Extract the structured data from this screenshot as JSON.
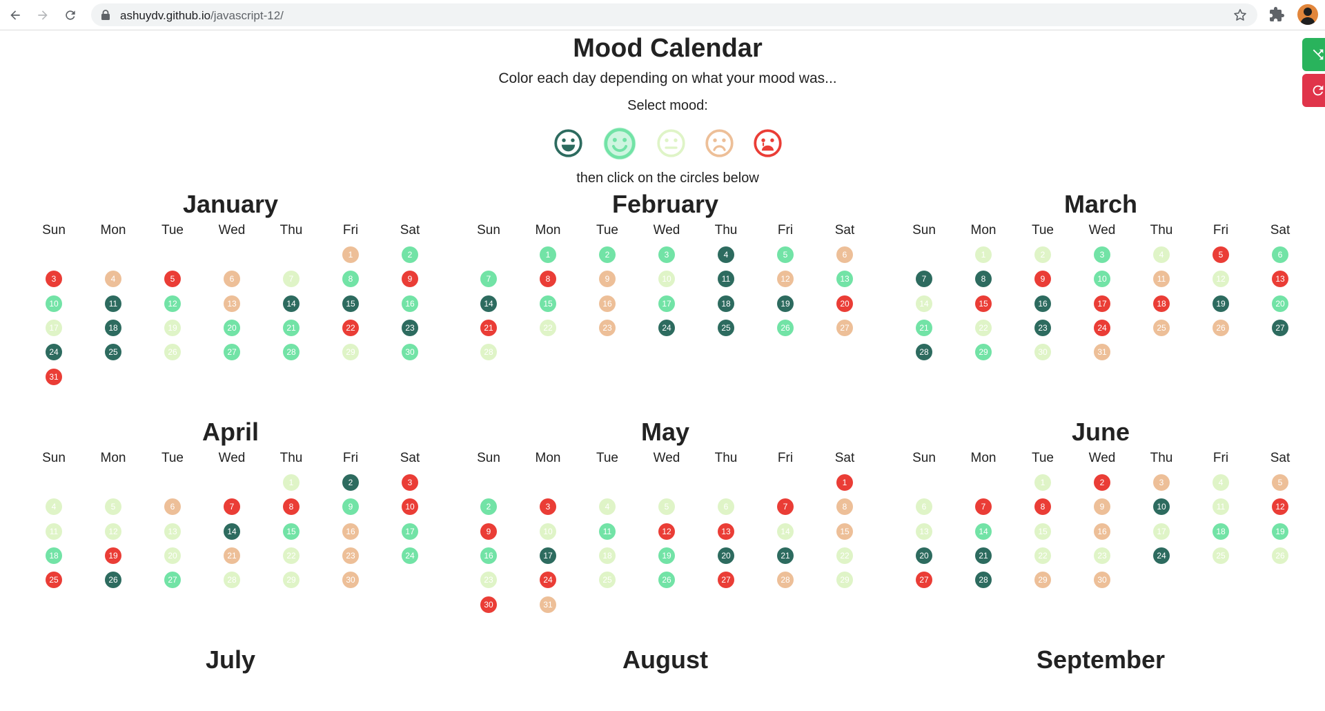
{
  "browser": {
    "url_host": "ashuydv.github.io",
    "url_path": "/javascript-12/"
  },
  "header": {
    "title": "Mood Calendar",
    "subtitle": "Color each day depending on what your mood was...",
    "select_label": "Select mood:",
    "hint": "then click on the circles below"
  },
  "colors": {
    "m1": "#2d6b5f",
    "m2": "#72e3a6",
    "m3": "#dff4c7",
    "m4": "#edbf98",
    "m5": "#ea3d36"
  },
  "moods": [
    {
      "name": "very-happy",
      "color": "#2d6b5f"
    },
    {
      "name": "happy",
      "color": "#72e3a6",
      "selected": true
    },
    {
      "name": "neutral",
      "color": "#dff4c7"
    },
    {
      "name": "sad",
      "color": "#edbf98"
    },
    {
      "name": "very-sad",
      "color": "#ea3d36"
    }
  ],
  "weekdays": [
    "Sun",
    "Mon",
    "Tue",
    "Wed",
    "Thu",
    "Fri",
    "Sat"
  ],
  "months": [
    {
      "name": "January",
      "start": 5,
      "days": 31,
      "moods": [
        4,
        2,
        5,
        4,
        5,
        4,
        3,
        2,
        5,
        2,
        1,
        2,
        4,
        1,
        1,
        2,
        3,
        1,
        3,
        2,
        2,
        5,
        1,
        1,
        1,
        3,
        2,
        2,
        3,
        2,
        5
      ]
    },
    {
      "name": "February",
      "start": 1,
      "days": 28,
      "moods": [
        2,
        2,
        2,
        1,
        2,
        4,
        2,
        5,
        4,
        3,
        1,
        4,
        2,
        1,
        2,
        4,
        2,
        1,
        1,
        5,
        5,
        3,
        4,
        1,
        1,
        2,
        4,
        3
      ]
    },
    {
      "name": "March",
      "start": 1,
      "days": 31,
      "moods": [
        3,
        3,
        2,
        3,
        5,
        2,
        1,
        1,
        5,
        2,
        4,
        3,
        5,
        3,
        5,
        1,
        5,
        5,
        1,
        2,
        2,
        3,
        1,
        5,
        4,
        4,
        1,
        1,
        2,
        3,
        4
      ]
    },
    {
      "name": "April",
      "start": 4,
      "days": 30,
      "moods": [
        3,
        1,
        5,
        3,
        3,
        4,
        5,
        5,
        2,
        5,
        3,
        3,
        3,
        1,
        2,
        4,
        2,
        2,
        5,
        3,
        4,
        3,
        4,
        2,
        5,
        1,
        2,
        3,
        3,
        4
      ]
    },
    {
      "name": "May",
      "start": 6,
      "days": 31,
      "moods": [
        5,
        2,
        5,
        3,
        3,
        3,
        5,
        4,
        5,
        3,
        2,
        5,
        5,
        3,
        4,
        2,
        1,
        3,
        2,
        1,
        1,
        3,
        3,
        5,
        3,
        2,
        5,
        4,
        3,
        5,
        4
      ]
    },
    {
      "name": "June",
      "start": 2,
      "days": 30,
      "moods": [
        3,
        5,
        4,
        3,
        4,
        3,
        5,
        5,
        4,
        1,
        3,
        5,
        3,
        2,
        3,
        4,
        3,
        2,
        2,
        1,
        1,
        3,
        3,
        1,
        3,
        3,
        5,
        1,
        4,
        4
      ]
    },
    {
      "name": "July"
    },
    {
      "name": "August"
    },
    {
      "name": "September"
    }
  ]
}
